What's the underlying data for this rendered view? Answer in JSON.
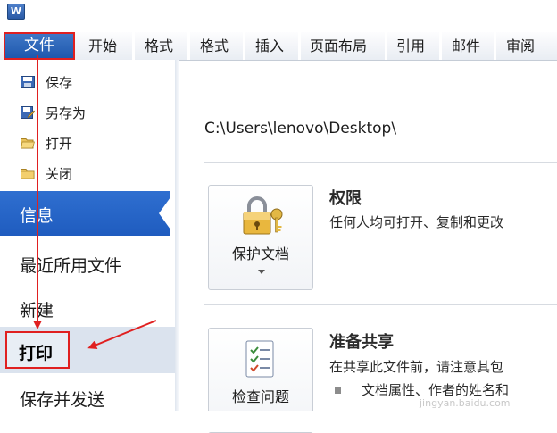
{
  "app": {
    "icon_letter": "W"
  },
  "ribbon": {
    "file_tab": "文件",
    "tabs": [
      "开始",
      "格式",
      "格式",
      "插入",
      "页面布局",
      "引用",
      "邮件",
      "审阅"
    ]
  },
  "backstage_nav": {
    "small_items": [
      {
        "label": "保存",
        "icon": "save-icon"
      },
      {
        "label": "另存为",
        "icon": "save-as-icon"
      },
      {
        "label": "打开",
        "icon": "open-folder-icon"
      },
      {
        "label": "关闭",
        "icon": "close-folder-icon"
      }
    ],
    "info": "信息",
    "recent": "最近所用文件",
    "new": "新建",
    "print": "打印",
    "save_send": "保存并发送"
  },
  "info_pane": {
    "path": "C:\\Users\\lenovo\\Desktop\\",
    "permissions": {
      "button_label": "保护文档",
      "button_icon": "lock-key-icon",
      "title": "权限",
      "description": "任何人均可打开、复制和更改"
    },
    "prepare_share": {
      "button_label": "检查问题",
      "button_icon": "checklist-icon",
      "title": "准备共享",
      "description": "在共享此文件前，请注意其包",
      "bullet": "文档属性、作者的姓名和"
    }
  },
  "colors": {
    "file_tab_blue": "#1e58ad",
    "info_selected_blue": "#2a68cc",
    "annotation_red": "#e02020"
  },
  "watermark": "jingyan.baidu.com"
}
